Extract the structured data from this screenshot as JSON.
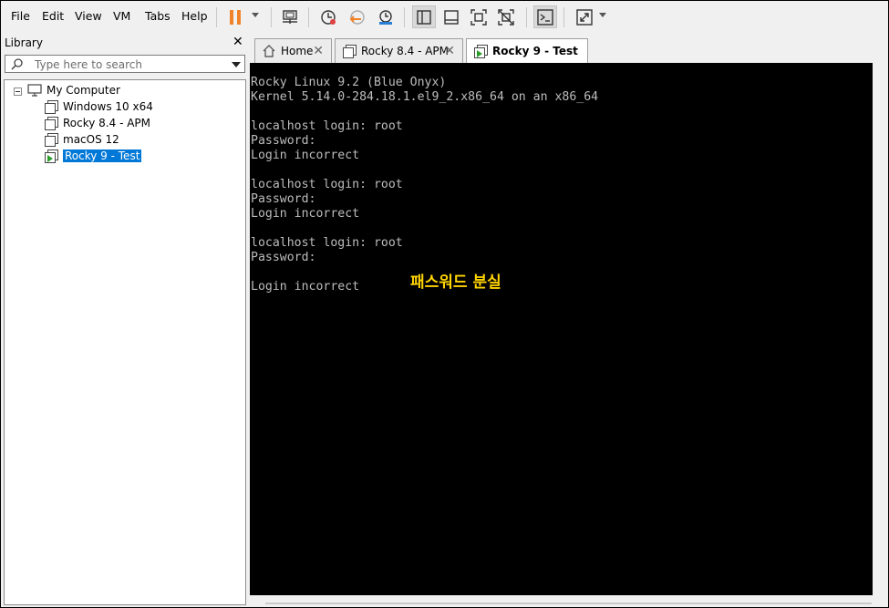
{
  "menu": [
    "File",
    "Edit",
    "View",
    "VM",
    "Tabs",
    "Help"
  ],
  "toolbar_icons": [
    "pause-icon",
    "send-ctrl-alt-del-icon",
    "snapshot-icon",
    "revert-snapshot-icon",
    "snapshot-manager-icon",
    "library-view-icon",
    "console-view-icon",
    "fullscreen-icon",
    "unity-icon",
    "terminal-icon",
    "stretch-icon"
  ],
  "library": {
    "title": "Library",
    "search_placeholder": "Type here to search",
    "root": "My Computer",
    "vms": [
      "Windows 10 x64",
      "Rocky 8.4 - APM",
      "macOS 12",
      "Rocky 9 - Test"
    ],
    "selected": "Rocky 9 - Test"
  },
  "tabs": [
    {
      "label": "Home",
      "icon": "home-icon",
      "active": false
    },
    {
      "label": "Rocky 8.4 - APM",
      "icon": "vm-icon",
      "active": false
    },
    {
      "label": "Rocky 9 - Test",
      "icon": "vm-running-icon",
      "active": true
    }
  ],
  "console": {
    "lines": [
      "Rocky Linux 9.2 (Blue Onyx)",
      "Kernel 5.14.0-284.18.1.el9_2.x86_64 on an x86_64",
      "",
      "localhost login: root",
      "Password:",
      "Login incorrect",
      "",
      "localhost login: root",
      "Password:",
      "Login incorrect",
      "",
      "localhost login: root",
      "Password:",
      "",
      "Login incorrect"
    ],
    "annotation": "패스워드 분실"
  },
  "colors": {
    "selection": "#0078d7",
    "pause": "#f0832a",
    "annotation": "#ffd400",
    "console_bg": "#000000",
    "console_text": "#bdbdbd"
  }
}
